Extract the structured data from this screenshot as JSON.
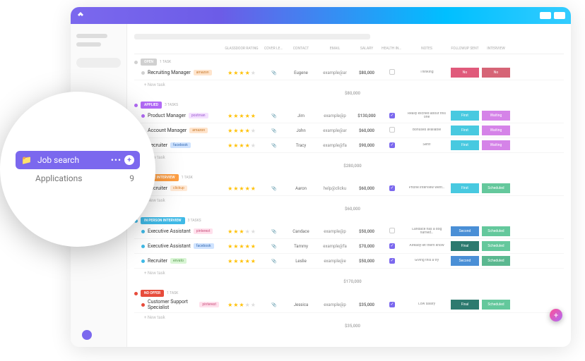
{
  "magnify": {
    "folder_label": "Job search",
    "sub_label": "Applications",
    "sub_count": "9"
  },
  "headers": {
    "rating": "GLASSDOOR RATING",
    "cover": "COVER LETTER",
    "contact": "CONTACT",
    "email": "EMAIL",
    "salary": "SALARY",
    "health": "HEALTH INSURANCE",
    "notes": "NOTES",
    "followup": "FOLLOWUP SENT",
    "interview": "INTERVIEW"
  },
  "groups": [
    {
      "status": "OPEN",
      "status_color": "#d0d0d0",
      "count": "1 TASK",
      "rows": [
        {
          "dot": "#d0d0d0",
          "title": "Recruiting Manager",
          "company": "amazon",
          "company_bg": "#ffe4cc",
          "company_fg": "#c67a2c",
          "stars": 4,
          "cover": "📎",
          "contact": "Eugene",
          "email": "example@ar",
          "salary": "$80,000",
          "health": false,
          "notes": "Thinking",
          "fu": "No",
          "fu_bg": "#e05a7b",
          "iv": "No",
          "iv_bg": "#d66476"
        }
      ],
      "total": "$80,000",
      "new": "+ New task"
    },
    {
      "status": "APPLIED",
      "status_color": "#b26af6",
      "count": "3 TASKS",
      "rows": [
        {
          "dot": "#b26af6",
          "title": "Product Manager",
          "company": "postman",
          "company_bg": "#f4e1ff",
          "company_fg": "#9b59d0",
          "stars": 5,
          "cover": "📎",
          "contact": "Jim",
          "email": "example@p",
          "salary": "$130,000",
          "health": true,
          "notes": "Really excited about this one",
          "fu": "First",
          "fu_bg": "#48c9e0",
          "iv": "Waiting",
          "iv_bg": "#d583e8"
        },
        {
          "dot": "#b26af6",
          "title": "Account Manager",
          "company": "amazon",
          "company_bg": "#ffe4cc",
          "company_fg": "#c67a2c",
          "stars": 4,
          "cover": "📎",
          "contact": "John",
          "email": "example@ar",
          "salary": "$60,000",
          "health": false,
          "notes": "Bonuses available",
          "fu": "First",
          "fu_bg": "#48c9e0",
          "iv": "Waiting",
          "iv_bg": "#d583e8"
        },
        {
          "dot": "#b26af6",
          "title": "Recruiter",
          "company": "facebook",
          "company_bg": "#cfe3ff",
          "company_fg": "#3b6fb5",
          "stars": 4,
          "cover": "📎",
          "contact": "Tracy",
          "email": "example@fa",
          "salary": "$90,000",
          "health": true,
          "notes": "Sent!",
          "fu": "First",
          "fu_bg": "#48c9e0",
          "iv": "Waiting",
          "iv_bg": "#d583e8"
        }
      ],
      "total": "$280,000",
      "new": "+ New task"
    },
    {
      "status": "PHONE INTERVIEW",
      "status_color": "#ff9f43",
      "count": "1 TASK",
      "rows": [
        {
          "dot": "#ff9f43",
          "title": "Recruiter",
          "company": "clickup",
          "company_bg": "#ffe9d6",
          "company_fg": "#d8822c",
          "stars": 5,
          "cover": "📎",
          "contact": "Aaron",
          "email": "help@clicku",
          "salary": "$60,000",
          "health": true,
          "notes": "Phone interview went…",
          "fu": "First",
          "fu_bg": "#48c9e0",
          "iv": "Scheduled",
          "iv_bg": "#64c89c"
        }
      ],
      "total": "$60,000",
      "new": "+ New task"
    },
    {
      "status": "IN PERSON INTERVIEW",
      "status_color": "#3fb9e6",
      "count": "3 TASKS",
      "rows": [
        {
          "dot": "#3fb9e6",
          "title": "Executive Assistant",
          "company": "pinterest",
          "company_bg": "#ffe0ec",
          "company_fg": "#c94f7c",
          "stars": 3,
          "cover": "📎",
          "contact": "Candace",
          "email": "example@p",
          "salary": "$50,000",
          "health": false,
          "notes": "Candace has a dog named…",
          "fu": "Second",
          "fu_bg": "#4a8fd6",
          "iv": "Scheduled",
          "iv_bg": "#64c89c"
        },
        {
          "dot": "#3fb9e6",
          "title": "Executive Assistant",
          "company": "facebook",
          "company_bg": "#cfe3ff",
          "company_fg": "#3b6fb5",
          "stars": 5,
          "cover": "📎",
          "contact": "Tammy",
          "email": "example@fa",
          "salary": "$70,000",
          "health": true,
          "notes": "Already let them know",
          "fu": "Final",
          "fu_bg": "#2d7a6f",
          "iv": "Scheduled",
          "iv_bg": "#64c89c"
        },
        {
          "dot": "#3fb9e6",
          "title": "Recruiter",
          "company": "envato",
          "company_bg": "#d8f5d4",
          "company_fg": "#5a9c52",
          "stars": 5,
          "cover": "📎",
          "contact": "Leslie",
          "email": "example@e",
          "salary": "$50,000",
          "health": true,
          "notes": "Giving this a try",
          "fu": "Second",
          "fu_bg": "#4a8fd6",
          "iv": "Scheduled",
          "iv_bg": "#5bb890"
        }
      ],
      "total": "$170,000",
      "new": "+ New task"
    },
    {
      "status": "NO OFFER",
      "status_color": "#e74c3c",
      "count": "1 TASK",
      "rows": [
        {
          "dot": "#e74c3c",
          "title": "Customer Support Specialist",
          "company": "pinterest",
          "company_bg": "#ffe0ec",
          "company_fg": "#c94f7c",
          "stars": 3,
          "cover": "📎",
          "contact": "Jessica",
          "email": "example@p",
          "salary": "$35,000",
          "health": true,
          "notes": "Low salary",
          "fu": "Final",
          "fu_bg": "#2d7a6f",
          "iv": "Scheduled",
          "iv_bg": "#64c89c"
        }
      ],
      "total": "$35,000",
      "new": "+ New task"
    }
  ]
}
